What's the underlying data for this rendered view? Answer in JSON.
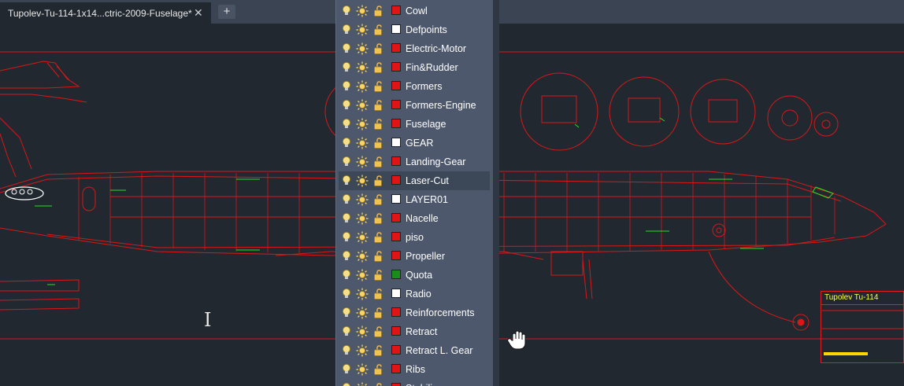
{
  "tab": {
    "title": "Tupolev-Tu-114-1x14...ctric-2009-Fuselage*",
    "close_label": "✕",
    "add_label": "+"
  },
  "titleblock": {
    "title": "Tupolev Tu-114"
  },
  "colors": {
    "red": "#e01414",
    "white": "#ffffff",
    "green": "#1a8c1a",
    "drawing_line": "#d81818",
    "annotation": "#22e022"
  },
  "layers": [
    {
      "name": "Cowl",
      "color": "#e01414",
      "selected": false
    },
    {
      "name": "Defpoints",
      "color": "#ffffff",
      "selected": false
    },
    {
      "name": "Electric-Motor",
      "color": "#e01414",
      "selected": false
    },
    {
      "name": "Fin&Rudder",
      "color": "#e01414",
      "selected": false
    },
    {
      "name": "Formers",
      "color": "#e01414",
      "selected": false
    },
    {
      "name": "Formers-Engine",
      "color": "#e01414",
      "selected": false
    },
    {
      "name": "Fuselage",
      "color": "#e01414",
      "selected": false
    },
    {
      "name": "GEAR",
      "color": "#ffffff",
      "selected": false
    },
    {
      "name": "Landing-Gear",
      "color": "#e01414",
      "selected": false
    },
    {
      "name": "Laser-Cut",
      "color": "#e01414",
      "selected": true
    },
    {
      "name": "LAYER01",
      "color": "#ffffff",
      "selected": false
    },
    {
      "name": "Nacelle",
      "color": "#e01414",
      "selected": false
    },
    {
      "name": "piso",
      "color": "#e01414",
      "selected": false
    },
    {
      "name": "Propeller",
      "color": "#e01414",
      "selected": false
    },
    {
      "name": "Quota",
      "color": "#1a8c1a",
      "selected": false
    },
    {
      "name": "Radio",
      "color": "#ffffff",
      "selected": false
    },
    {
      "name": "Reinforcements",
      "color": "#e01414",
      "selected": false
    },
    {
      "name": "Retract",
      "color": "#e01414",
      "selected": false
    },
    {
      "name": "Retract L. Gear",
      "color": "#e01414",
      "selected": false
    },
    {
      "name": "Ribs",
      "color": "#e01414",
      "selected": false
    },
    {
      "name": "Stabilizer",
      "color": "#e01414",
      "selected": false
    }
  ]
}
